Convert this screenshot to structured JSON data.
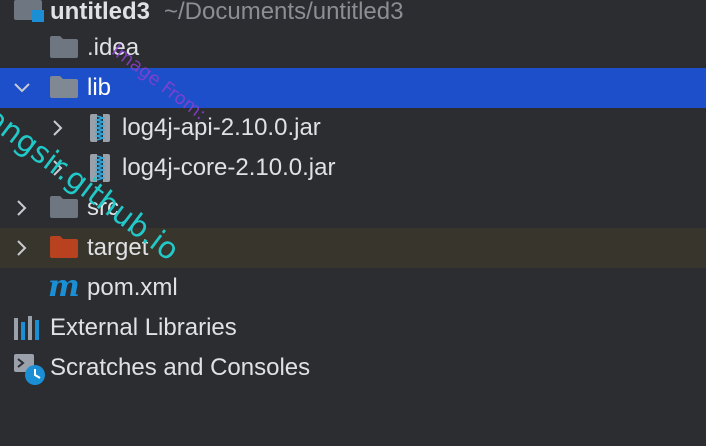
{
  "project": {
    "name": "untitled3",
    "path": "~/Documents/untitled3"
  },
  "tree": {
    "idea_label": ".idea",
    "lib_label": "lib",
    "jar1_label": "log4j-api-2.10.0.jar",
    "jar2_label": "log4j-core-2.10.0.jar",
    "src_label": "src",
    "target_label": "target",
    "pom_label": "pom.xml",
    "ext_label": "External Libraries",
    "scratch_label": "Scratches and Consoles"
  },
  "watermark": {
    "line1": "yangsir.github.io",
    "line2": "Image From:"
  },
  "icons": {
    "folder": "folder-icon",
    "excluded_folder": "excluded-folder-icon",
    "jar": "jar-archive-icon",
    "maven": "maven-icon",
    "libraries": "libraries-icon",
    "scratches": "scratches-icon",
    "chevron_right": "chevron-right-icon",
    "chevron_down": "chevron-down-icon"
  },
  "colors": {
    "background": "#2b2d30",
    "selection": "#1c4fc9",
    "highlight_row": "#38352c",
    "folder": "#6e7781",
    "excluded_folder": "#b8421f",
    "maven": "#1a8fd6",
    "watermark_cyan": "#22c9c9",
    "watermark_purple": "#8b3fd1"
  }
}
